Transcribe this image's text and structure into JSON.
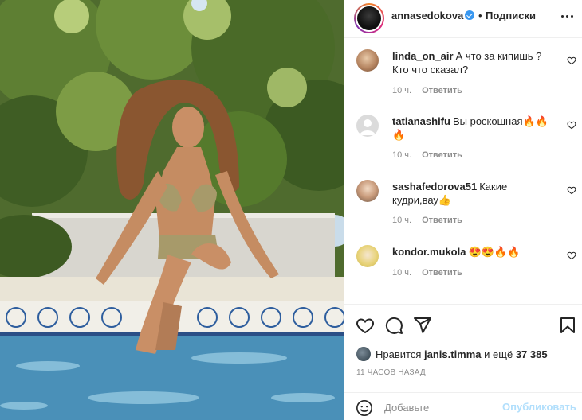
{
  "post": {
    "username": "annasedokova",
    "separator": "•",
    "follow_label": "Подписки",
    "more_icon": "more-horizontal-icon",
    "verified_icon": "verified-badge-icon"
  },
  "comments": [
    {
      "user": "linda_on_air",
      "text": "А что за кипишь ? Кто что сказал?",
      "time": "10 ч.",
      "reply": "Ответить"
    },
    {
      "user": "tatianashifu",
      "text": "Вы роскошная🔥🔥🔥",
      "time": "10 ч.",
      "reply": "Ответить"
    },
    {
      "user": "sashafedorova51",
      "text": "Какие кудри,вау👍",
      "time": "10 ч.",
      "reply": "Ответить"
    },
    {
      "user": "kondor.mukola",
      "text": "😍😍🔥🔥",
      "time": "10 ч.",
      "reply": "Ответить"
    }
  ],
  "actions": {
    "like_icon": "heart-icon",
    "comment_icon": "comment-icon",
    "share_icon": "send-icon",
    "save_icon": "bookmark-icon"
  },
  "likes": {
    "prefix": "Нравится",
    "user": "janis.timma",
    "middle": "и ещё",
    "count": "37 385"
  },
  "time_ago": "11 ЧАСОВ НАЗАД",
  "comment_box": {
    "placeholder": "Добавьте",
    "publish_label": "Опубликовать",
    "emoji_icon": "smiley-icon"
  },
  "colors": {
    "link_blue": "#3897f0",
    "publish_disabled": "#b2dffc",
    "muted": "#8e8e8e",
    "text": "#262626"
  }
}
